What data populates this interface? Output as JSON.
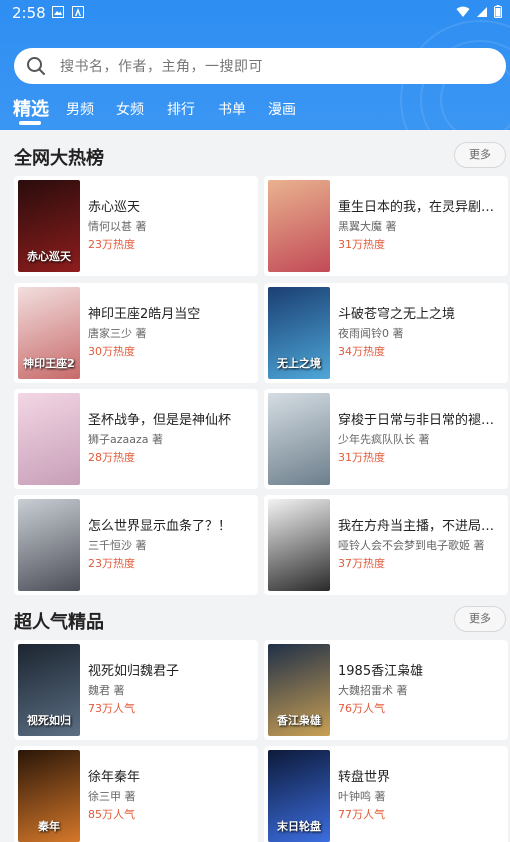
{
  "status_bar": {
    "time": "2:58"
  },
  "search": {
    "placeholder": "搜书名，作者，主角，一搜即可"
  },
  "tabs": [
    {
      "label": "精选"
    },
    {
      "label": "男频"
    },
    {
      "label": "女频"
    },
    {
      "label": "排行"
    },
    {
      "label": "书单"
    },
    {
      "label": "漫画"
    }
  ],
  "sections": [
    {
      "title": "全网大热榜",
      "more_label": "更多",
      "books": [
        {
          "title": "赤心巡天",
          "author": "情何以甚 著",
          "heat": "23万热度",
          "cover_text": "赤心巡天",
          "cover_colors": [
            "#2a0c0c",
            "#8e1d1d"
          ]
        },
        {
          "title": "重生日本的我，在灵异剧…",
          "author": "黑翼大魔 著",
          "heat": "31万热度",
          "cover_text": "",
          "cover_colors": [
            "#e9b28f",
            "#c24a57"
          ]
        },
        {
          "title": "神印王座2皓月当空",
          "author": "唐家三少 著",
          "heat": "30万热度",
          "cover_text": "神印王座2",
          "cover_colors": [
            "#f2dede",
            "#c86a6a"
          ]
        },
        {
          "title": "斗破苍穹之无上之境",
          "author": "夜雨闻铃0 著",
          "heat": "34万热度",
          "cover_text": "无上之境",
          "cover_colors": [
            "#1b3f73",
            "#4ea7d8"
          ]
        },
        {
          "title": "圣杯战争，但是是神仙杯",
          "author": "狮子azaaza 著",
          "heat": "28万热度",
          "cover_text": "",
          "cover_colors": [
            "#f3d6e4",
            "#c79fb8"
          ]
        },
        {
          "title": "穿梭于日常与非日常的褪…",
          "author": "少年先疯队队长 著",
          "heat": "31万热度",
          "cover_text": "",
          "cover_colors": [
            "#d5dde3",
            "#6d7f8c"
          ]
        },
        {
          "title": "怎么世界显示血条了？！",
          "author": "三千恒沙 著",
          "heat": "23万热度",
          "cover_text": "",
          "cover_colors": [
            "#c9ced4",
            "#4d4f58"
          ]
        },
        {
          "title": "我在方舟当主播，不进局…",
          "author": "哑铃人会不会梦到电子歌姬 著",
          "heat": "37万热度",
          "cover_text": "",
          "cover_colors": [
            "#f3f3f3",
            "#2a2a2a"
          ]
        }
      ]
    },
    {
      "title": "超人气精品",
      "more_label": "更多",
      "books": [
        {
          "title": "视死如归魏君子",
          "author": "魏君 著",
          "heat": "73万人气",
          "cover_text": "视死如归",
          "cover_colors": [
            "#1c2530",
            "#5b6f84"
          ]
        },
        {
          "title": "1985香江枭雄",
          "author": "大魏招雷术 著",
          "heat": "76万人气",
          "cover_text": "香江枭雄",
          "cover_colors": [
            "#203048",
            "#c9a054"
          ]
        },
        {
          "title": "徐年秦年",
          "author": "徐三甲 著",
          "heat": "85万人气",
          "cover_text": "秦年",
          "cover_colors": [
            "#2a1608",
            "#d5782a"
          ]
        },
        {
          "title": "转盘世界",
          "author": "叶钟鸣 著",
          "heat": "77万人气",
          "cover_text": "末日轮盘",
          "cover_colors": [
            "#0d1a3a",
            "#3c6ee0"
          ]
        }
      ]
    }
  ]
}
